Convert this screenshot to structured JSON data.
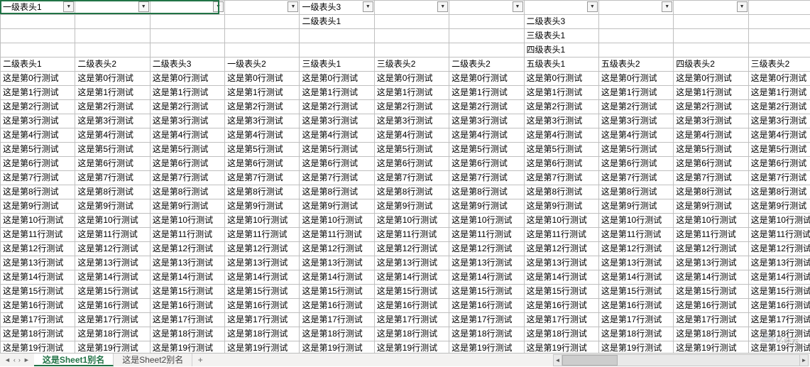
{
  "columns": 11,
  "rows": 21,
  "cell_template_prefix": "这是第",
  "cell_template_suffix": "行测试",
  "filter_row_cells": [
    "一级表头1",
    "",
    "",
    "",
    "一级表头3",
    "",
    "",
    "",
    "",
    "",
    ""
  ],
  "header_row2": [
    "",
    "",
    "",
    "",
    "二级表头1",
    "",
    "",
    "二级表头3",
    "",
    "",
    ""
  ],
  "header_row3": [
    "",
    "",
    "",
    "",
    "",
    "",
    "",
    "三级表头1",
    "",
    "",
    ""
  ],
  "header_row4": [
    "",
    "",
    "",
    "",
    "",
    "",
    "",
    "四级表头1",
    "",
    "",
    ""
  ],
  "header_row5": [
    "二级表头1",
    "二级表头2",
    "二级表头3",
    "一级表头2",
    "三级表头1",
    "三级表头2",
    "二级表头2",
    "五级表头1",
    "五级表头2",
    "四级表头2",
    "三级表头2"
  ],
  "sheet_tabs": {
    "active": "这是Sheet1别名",
    "others": [
      "这是Sheet2别名"
    ],
    "add_label": "+"
  },
  "watermark_text": "亿速云",
  "chart_data": {
    "type": "table",
    "note": "Spreadsheet with multi-level merged header. Body cells follow pattern 这是第{row}行测试 for rows 0–20 across 11 columns.",
    "header_hierarchy": [
      {
        "label": "一级表头1",
        "span_cols": [
          0,
          1,
          2
        ],
        "children": [
          {
            "label": "二级表头1",
            "col": 0
          },
          {
            "label": "二级表头2",
            "col": 1
          },
          {
            "label": "二级表头3",
            "col": 2
          }
        ]
      },
      {
        "label": "一级表头2",
        "col": 3
      },
      {
        "label": "一级表头3",
        "span_cols": [
          4,
          5,
          6,
          7,
          8,
          9,
          10
        ],
        "children": [
          {
            "label": "二级表头1",
            "span_cols": [
              4,
              5
            ],
            "children": [
              {
                "label": "三级表头1",
                "col": 4
              },
              {
                "label": "三级表头2",
                "col": 5
              }
            ]
          },
          {
            "label": "二级表头2",
            "col": 6
          },
          {
            "label": "二级表头3",
            "span_cols": [
              7,
              8,
              9,
              10
            ],
            "children": [
              {
                "label": "三级表头1",
                "span_cols": [
                  7,
                  8,
                  9
                ],
                "children": [
                  {
                    "label": "四级表头1",
                    "span_cols": [
                      7,
                      8
                    ],
                    "children": [
                      {
                        "label": "五级表头1",
                        "col": 7
                      },
                      {
                        "label": "五级表头2",
                        "col": 8
                      }
                    ]
                  },
                  {
                    "label": "四级表头2",
                    "col": 9
                  }
                ]
              },
              {
                "label": "三级表头2",
                "col": 10
              }
            ]
          }
        ]
      }
    ],
    "body_rows": 21,
    "body_columns": 11,
    "body_value_pattern": "这是第{i}行测试"
  }
}
